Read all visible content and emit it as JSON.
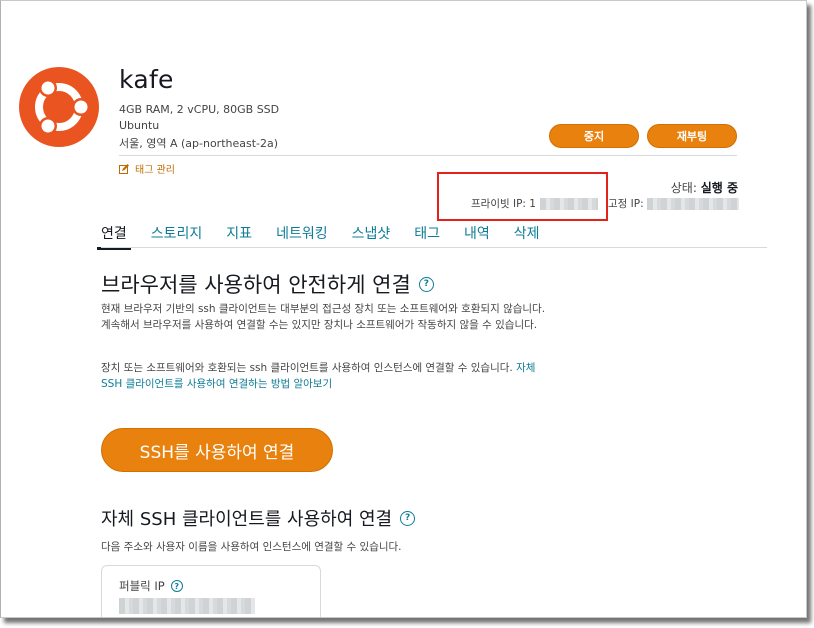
{
  "instance": {
    "name": "kafe",
    "specs": "4GB RAM, 2 vCPU, 80GB SSD",
    "os": "Ubuntu",
    "region": "서울, 영역 A (ap-northeast-2a)",
    "tag_manage": "태그 관리"
  },
  "actions": {
    "stop": "중지",
    "reboot": "재부팅"
  },
  "status": {
    "label": "상태:",
    "value": "실행 중"
  },
  "network": {
    "private_ip_label": "프라이빗 IP: 1",
    "static_ip_label": "고정 IP:"
  },
  "tabs": [
    "연결",
    "스토리지",
    "지표",
    "네트워킹",
    "스냅샷",
    "태그",
    "내역",
    "삭제"
  ],
  "browser_connect": {
    "heading": "브라우저를 사용하여 안전하게 연결",
    "para1": "현재 브라우저 기반의 ssh 클라이언트는 대부분의 접근성 장치 또는 소프트웨어와 호환되지 않습니다. 계속해서 브라우저를 사용하여 연결할 수는 있지만 장치나 소프트웨어가 작동하지 않을 수 있습니다.",
    "para2": "장치 또는 소프트웨어와 호환되는 ssh 클라이언트를 사용하여 인스턴스에 연결할 수 있습니다.",
    "link": "자체 SSH 클라이언트를 사용하여 연결하는 방법 알아보기",
    "button": "SSH를 사용하여 연결"
  },
  "own_client": {
    "heading": "자체 SSH 클라이언트를 사용하여 연결",
    "desc": "다음 주소와 사용자 이름을 사용하여 인스턴스에 연결할 수 있습니다.",
    "public_ip_label": "퍼블릭 IP"
  },
  "help_glyph": "?",
  "colors": {
    "accent": "#e8810d",
    "link": "#0e7c96",
    "ubuntu": "#e95420",
    "highlight": "#e2231a"
  }
}
